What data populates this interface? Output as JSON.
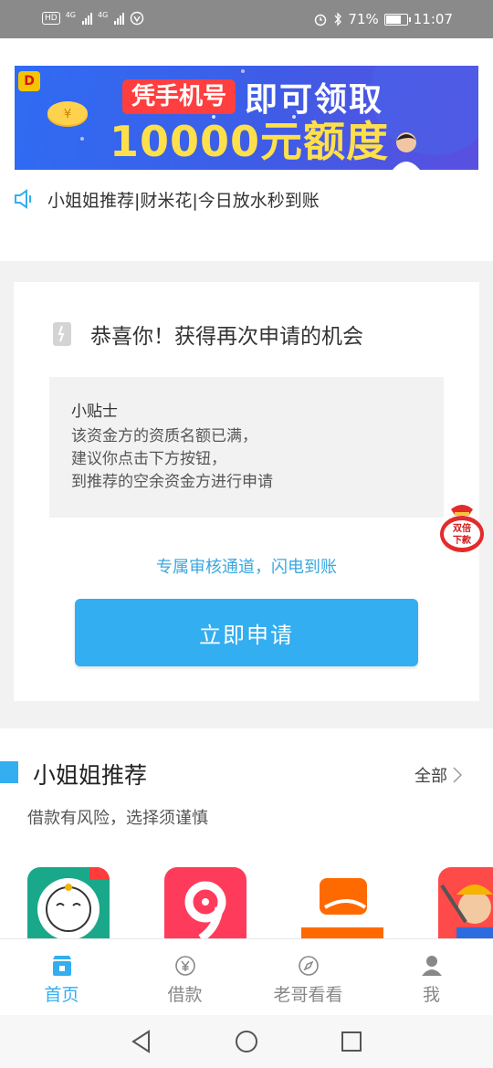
{
  "status_bar": {
    "hd": "HD",
    "net1": "4G",
    "net2": "4G",
    "battery_percent": "71%",
    "battery_level": 0.71,
    "time": "11:07"
  },
  "banner": {
    "logo": "D",
    "line1_pill": "凭手机号",
    "line1_rest": "即可领取",
    "line2": "10000元额度",
    "coin_symbol": "¥"
  },
  "notice": {
    "text": "小姐姐推荐|财米花|今日放水秒到账"
  },
  "card": {
    "title": "恭喜你！获得再次申请的机会",
    "tips_title": "小贴士",
    "tips_lines": [
      "该资金方的资质名额已满，",
      "建议你点击下方按钮，",
      "到推荐的空余资金方进行申请"
    ],
    "highlight": "专属审核通道，闪电到账",
    "apply_button": "立即申请"
  },
  "float_bag": {
    "line1": "双倍",
    "line2": "下款"
  },
  "recommend": {
    "title": "小姐姐推荐",
    "all_label": "全部",
    "subtitle": "借款有风险，选择须谨慎",
    "apps": [
      {
        "name": "lucky-cat-app",
        "color": "#1aa88a"
      },
      {
        "name": "nine-app",
        "color": "#ff3b5c"
      },
      {
        "name": "wallet-app",
        "color": "#ff6a00"
      },
      {
        "name": "miner-app",
        "color": "#ff4a4a"
      }
    ]
  },
  "tab_bar": {
    "tabs": [
      {
        "label": "首页",
        "icon": "home-icon",
        "active": true
      },
      {
        "label": "借款",
        "icon": "yen-icon",
        "active": false
      },
      {
        "label": "老哥看看",
        "icon": "compass-icon",
        "active": false
      },
      {
        "label": "我",
        "icon": "person-icon",
        "active": false
      }
    ]
  },
  "colors": {
    "accent": "#33aef0",
    "highlight_text": "#3aa7e0",
    "banner_yellow": "#ffe04a",
    "banner_red": "#ff3f3f"
  }
}
